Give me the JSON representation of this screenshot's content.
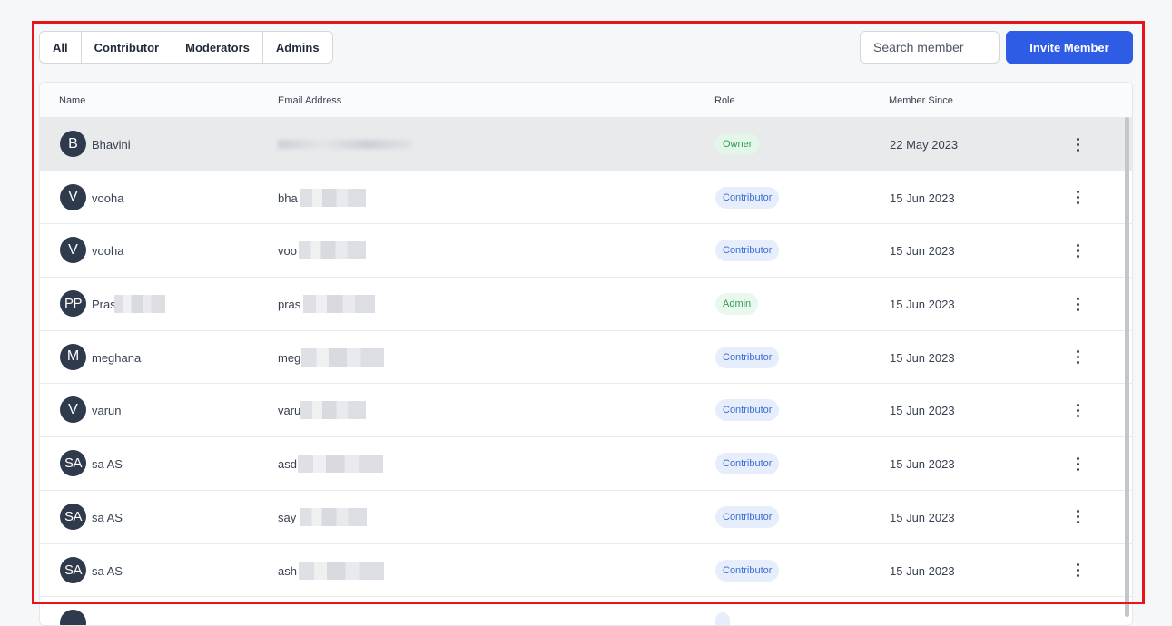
{
  "filters": [
    "All",
    "Contributor",
    "Moderators",
    "Admins"
  ],
  "search": {
    "placeholder": "Search member"
  },
  "invite_label": "Invite Member",
  "columns": {
    "name": "Name",
    "email": "Email Address",
    "role": "Role",
    "since": "Member Since"
  },
  "members": [
    {
      "initials": "B",
      "name": "Bhavini",
      "email": "",
      "role": "Owner",
      "since": "22 May 2023"
    },
    {
      "initials": "V",
      "name": "vooha",
      "email": "bha",
      "role": "Contributor",
      "since": "15 Jun 2023"
    },
    {
      "initials": "V",
      "name": "vooha",
      "email": "voo",
      "role": "Contributor",
      "since": "15 Jun 2023"
    },
    {
      "initials": "PP",
      "name": "Pras",
      "email": "pras",
      "role": "Admin",
      "since": "15 Jun 2023"
    },
    {
      "initials": "M",
      "name": "meghana",
      "email": "meg",
      "role": "Contributor",
      "since": "15 Jun 2023"
    },
    {
      "initials": "V",
      "name": "varun",
      "email": "varu",
      "role": "Contributor",
      "since": "15 Jun 2023"
    },
    {
      "initials": "SA",
      "name": "sa AS",
      "email": "asd",
      "role": "Contributor",
      "since": "15 Jun 2023"
    },
    {
      "initials": "SA",
      "name": "sa AS",
      "email": "say",
      "role": "Contributor",
      "since": "15 Jun 2023"
    },
    {
      "initials": "SA",
      "name": "sa AS",
      "email": "ash",
      "role": "Contributor",
      "since": "15 Jun 2023"
    }
  ],
  "icons": {
    "row_menu": "more-vertical-icon"
  },
  "colors": {
    "accent": "#2e5ce5",
    "highlight_border": "#e8141a"
  }
}
